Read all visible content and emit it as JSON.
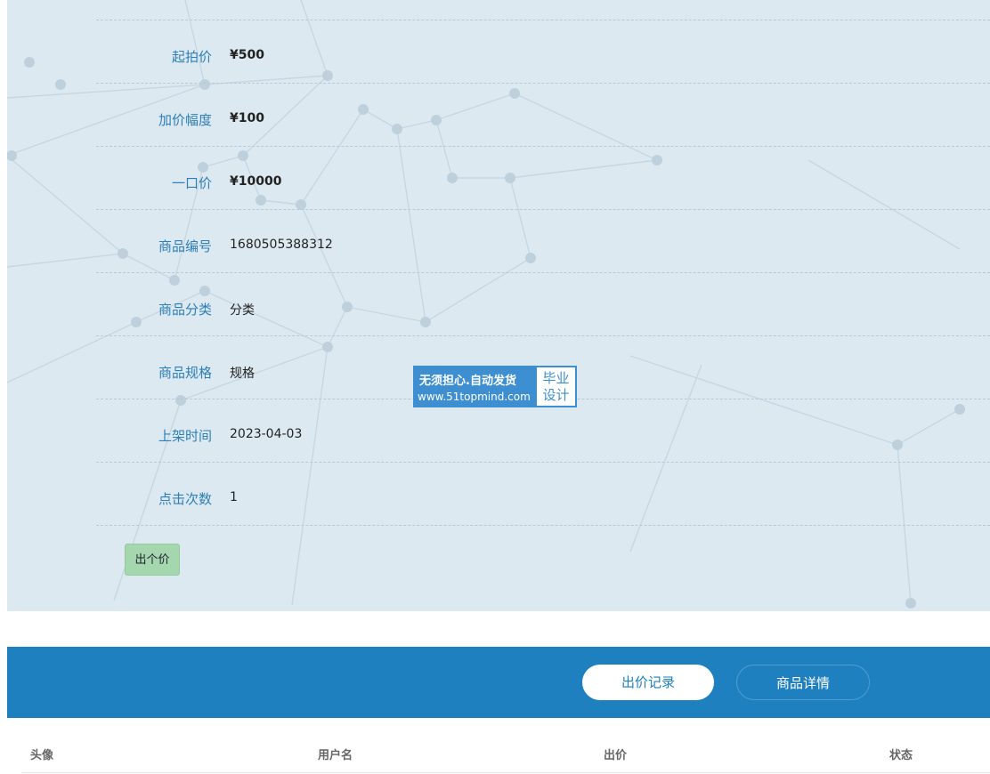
{
  "details": [
    {
      "label": "起拍价",
      "value": "¥500",
      "price": true
    },
    {
      "label": "加价幅度",
      "value": "¥100",
      "price": true
    },
    {
      "label": "一口价",
      "value": "¥10000",
      "price": true
    },
    {
      "label": "商品编号",
      "value": "1680505388312",
      "price": false
    },
    {
      "label": "商品分类",
      "value": "分类",
      "price": false
    },
    {
      "label": "商品规格",
      "value": "规格",
      "price": false
    },
    {
      "label": "上架时间",
      "value": "2023-04-03",
      "price": false
    },
    {
      "label": "点击次数",
      "value": "1",
      "price": false
    }
  ],
  "bid_button": "出个价",
  "watermark": {
    "line1": "无须担心.自动发货",
    "line2": "www.51topmind.com",
    "right1": "毕业",
    "right2": "设计"
  },
  "tabs": {
    "active": "出价记录",
    "inactive": "商品详情"
  },
  "table": {
    "headers": [
      "头像",
      "用户名",
      "出价",
      "状态"
    ]
  },
  "colors": {
    "label": "#2e7fb6",
    "tabbar": "#1f80c0",
    "bid_button": "#a4d7ad"
  }
}
